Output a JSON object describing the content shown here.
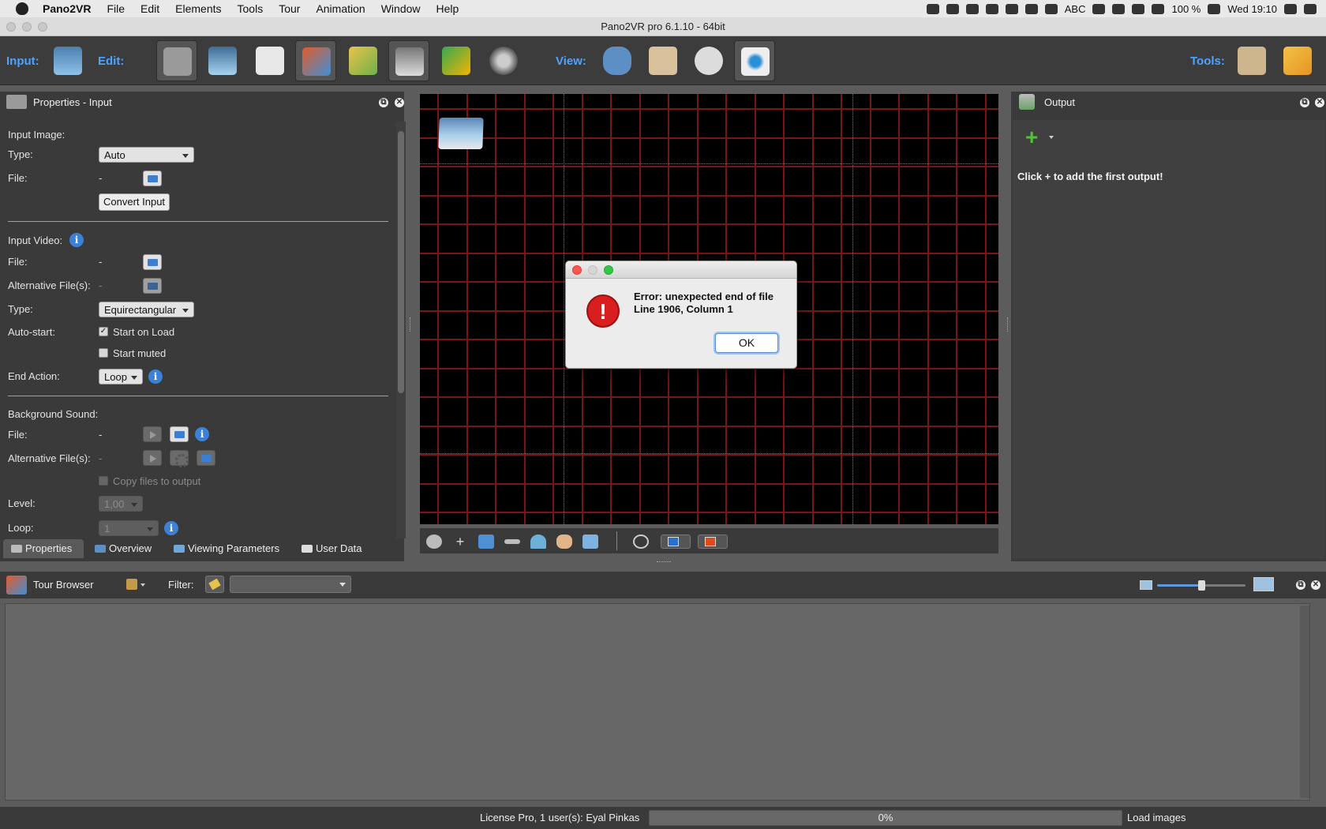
{
  "menubar": {
    "app_name": "Pano2VR",
    "items": [
      "File",
      "Edit",
      "Elements",
      "Tools",
      "Tour",
      "Animation",
      "Window",
      "Help"
    ],
    "status": {
      "input_source": "ABC",
      "battery": "100 %",
      "clock": "Wed 19:10"
    }
  },
  "window": {
    "title": "Pano2VR pro 6.1.10 - 64bit"
  },
  "toolbar": {
    "input_label": "Input:",
    "edit_label": "Edit:",
    "view_label": "View:",
    "tools_label": "Tools:"
  },
  "properties": {
    "title": "Properties - Input",
    "input_image": {
      "section": "Input Image:",
      "type_label": "Type:",
      "type_value": "Auto",
      "file_label": "File:",
      "file_value": "-",
      "convert_button": "Convert Input"
    },
    "input_video": {
      "section": "Input Video:",
      "file_label": "File:",
      "file_value": "-",
      "alt_label": "Alternative File(s):",
      "alt_value": "-",
      "type_label": "Type:",
      "type_value": "Equirectangular",
      "autostart_label": "Auto-start:",
      "start_on_load": "Start on Load",
      "start_on_load_checked": true,
      "start_muted": "Start muted",
      "start_muted_checked": false,
      "end_action_label": "End Action:",
      "end_action_value": "Loop"
    },
    "background_sound": {
      "section": "Background Sound:",
      "file_label": "File:",
      "file_value": "-",
      "alt_label": "Alternative File(s):",
      "alt_value": "-",
      "copy_files": "Copy files to output",
      "level_label": "Level:",
      "level_value": "1,00",
      "loop_label": "Loop:",
      "loop_value": "1"
    },
    "tabs": [
      "Properties",
      "Overview",
      "Viewing Parameters",
      "User Data"
    ],
    "active_tab": "Properties"
  },
  "dialog": {
    "line1": "Error: unexpected end of file",
    "line2": "Line 1906, Column 1",
    "ok_label": "OK",
    "icon_glyph": "!"
  },
  "output": {
    "title": "Output",
    "hint": "Click + to add the first output!"
  },
  "tour_browser": {
    "title": "Tour Browser",
    "filter_label": "Filter:",
    "filter_value": "",
    "thumbnail_size": 0.5
  },
  "status_bar": {
    "license": "License Pro, 1 user(s): Eyal Pinkas",
    "progress": "0%",
    "progress_value": 0,
    "action": "Load images"
  },
  "colors": {
    "accent": "#4ea3ff",
    "grid_line": "#7a1515",
    "error_red": "#d81e1e",
    "panel_bg": "#3a3a3a"
  }
}
